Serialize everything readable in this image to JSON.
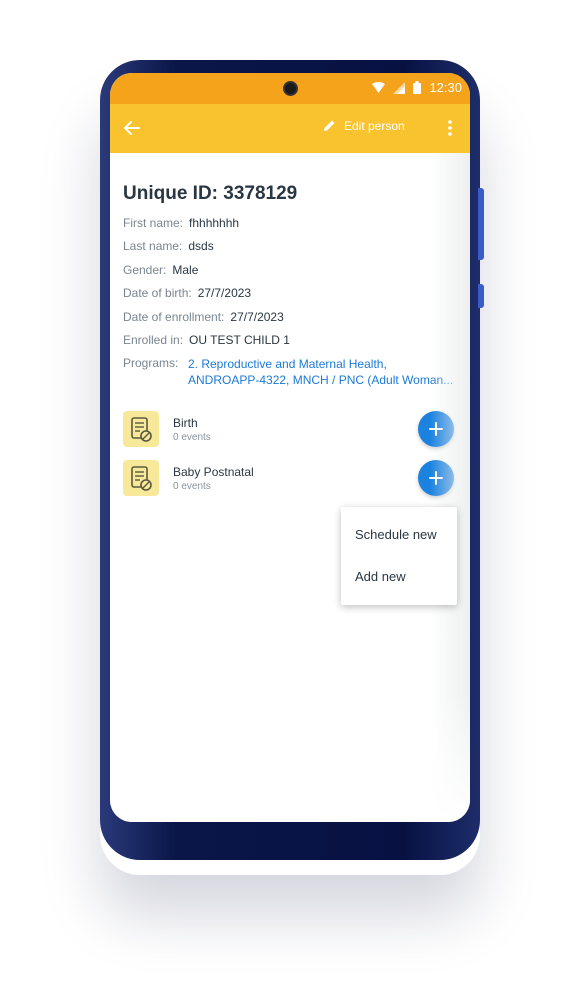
{
  "status_bar": {
    "time": "12:30",
    "icons": [
      "wifi-icon",
      "signal-icon",
      "battery-icon"
    ]
  },
  "toolbar": {
    "back_icon": "arrow-left-icon",
    "edit_label": "Edit person",
    "edit_icon": "pencil-icon",
    "menu_icon": "more-vert-icon",
    "color": "#f9c22f"
  },
  "person": {
    "unique_id": "Unique ID: 3378129",
    "fields": [
      {
        "label": "First name:",
        "value": "fhhhhhhh"
      },
      {
        "label": "Last name:",
        "value": "dsds"
      },
      {
        "label": "Gender:",
        "value": "Male"
      },
      {
        "label": "Date of birth:",
        "value": "27/7/2023"
      },
      {
        "label": "Date of enrollment:",
        "value": "27/7/2023"
      },
      {
        "label": "Enrolled in:",
        "value": "OU TEST CHILD 1"
      }
    ],
    "programs_label": "Programs:",
    "programs_line1": "2. Reproductive and Maternal Health,",
    "programs_line2": "ANDROAPP-4322, MNCH / PNC (Adult Woman..."
  },
  "stages": [
    {
      "name": "Birth",
      "events": "0 events",
      "icon": "document-icon"
    },
    {
      "name": "Baby Postnatal",
      "events": "0 events",
      "icon": "document-icon"
    }
  ],
  "popup_menu": {
    "items": [
      "Schedule new",
      "Add new"
    ]
  },
  "colors": {
    "status_bar": "#f5a31a",
    "accent_blue": "#1b82e0",
    "link_blue": "#1b7ad6",
    "stage_icon_bg": "#f8e89a"
  }
}
